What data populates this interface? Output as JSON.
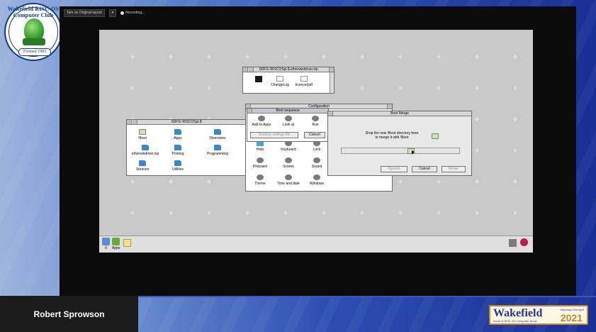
{
  "club_logo": {
    "text": "Wakefield RISC-OS Computer Club",
    "formed": "Formed 1983"
  },
  "toolbar": {
    "layout": "Tam on Original layout",
    "recording": "Recording..."
  },
  "windows": {
    "ethernet": {
      "title": "SDFS::RISCOSpi.$.etherwisdriver.zip",
      "items": [
        {
          "label": "",
          "icon": "app"
        },
        {
          "label": "ChangeLog",
          "icon": "doc"
        },
        {
          "label": "licence/pdf",
          "icon": "doc"
        }
      ]
    },
    "root": {
      "title": "SDFS::RISCOSpi.$",
      "items": [
        {
          "label": "!Boot",
          "icon": "app"
        },
        {
          "label": "Apps",
          "icon": "dir"
        },
        {
          "label": "Diversions",
          "icon": "dir"
        },
        {
          "label": "etherwisdriver.zip",
          "icon": "dir"
        },
        {
          "label": "Printing",
          "icon": "dir"
        },
        {
          "label": "Programming",
          "icon": "dir"
        },
        {
          "label": "Sources",
          "icon": "dir"
        },
        {
          "label": "Utilities",
          "icon": "dir"
        }
      ]
    },
    "configuration": {
      "title": "Configuration",
      "items": [
        {
          "label": "Help",
          "icon": "cyan"
        },
        {
          "label": "Keyboard",
          "icon": "gear"
        },
        {
          "label": "Lock",
          "icon": "gear"
        },
        {
          "label": "Pinboard",
          "icon": "gear"
        },
        {
          "label": "Screen",
          "icon": "gear"
        },
        {
          "label": "Sound",
          "icon": "gear"
        },
        {
          "label": "Theme",
          "icon": "gear"
        },
        {
          "label": "Time and date",
          "icon": "gear"
        },
        {
          "label": "Windows",
          "icon": "gear"
        }
      ]
    },
    "boot_sequence": {
      "title": "Boot sequence",
      "actions": [
        {
          "label": "Add to Apps"
        },
        {
          "label": "Look at"
        },
        {
          "label": "Run"
        }
      ],
      "desktop_settings_button": "Desktop settings file",
      "cancel_button": "Cancel"
    },
    "boot_merge": {
      "title": "Boot Merge",
      "message_line1": "Drop the new !Boot directory here",
      "message_line2": "to merge it with !Boot",
      "agenda_button": "Agenda",
      "cancel_button": "Cancel",
      "merge_button": "Merge"
    }
  },
  "iconbar": {
    "drive_label": "0",
    "apps_label": "Apps"
  },
  "presenter": {
    "name": "Robert Sprowson"
  },
  "event_badge": {
    "word": "Wakefield",
    "year": "2021",
    "date": "Saturday 24th April",
    "subtitle": "Acorn & RISC OS Computer Show"
  }
}
